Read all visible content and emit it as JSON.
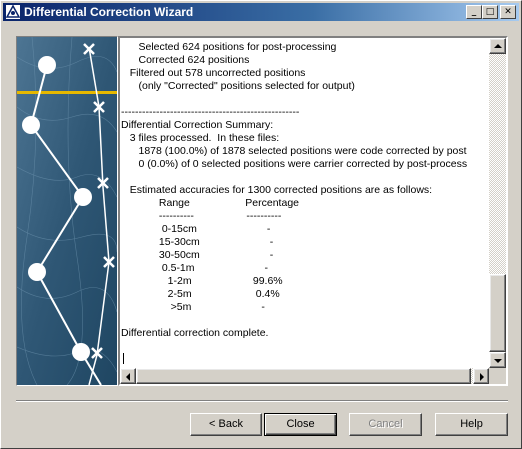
{
  "window": {
    "title": "Differential Correction Wizard",
    "icon": "gps-app-icon",
    "controls": {
      "minimize": "_",
      "maximize": "□",
      "close": "✕"
    }
  },
  "image": {
    "description_icon": "gps-path-illustration"
  },
  "log": {
    "lines": [
      "      Selected 624 positions for post-processing",
      "      Corrected 624 positions",
      "   Filtered out 578 uncorrected positions",
      "      (only \"Corrected\" positions selected for output)",
      "",
      "---------------------------------------------------",
      "Differential Correction Summary:",
      "   3 files processed.  In these files:",
      "      1878 (100.0%) of 1878 selected positions were code corrected by post",
      "      0 (0.0%) of 0 selected positions were carrier corrected by post-process",
      "",
      "   Estimated accuracies for 1300 corrected positions are as follows:",
      "             Range                   Percentage",
      "             ----------                  ----------",
      "              0-15cm                        -",
      "             15-30cm                        -",
      "             30-50cm                        -",
      "              0.5-1m                        -",
      "                1-2m                     99.6%",
      "                2-5m                      0.4%",
      "                 >5m                        -",
      "",
      "Differential correction complete."
    ]
  },
  "buttons": {
    "back": "< Back",
    "close": "Close",
    "cancel": "Cancel",
    "help": "Help"
  }
}
